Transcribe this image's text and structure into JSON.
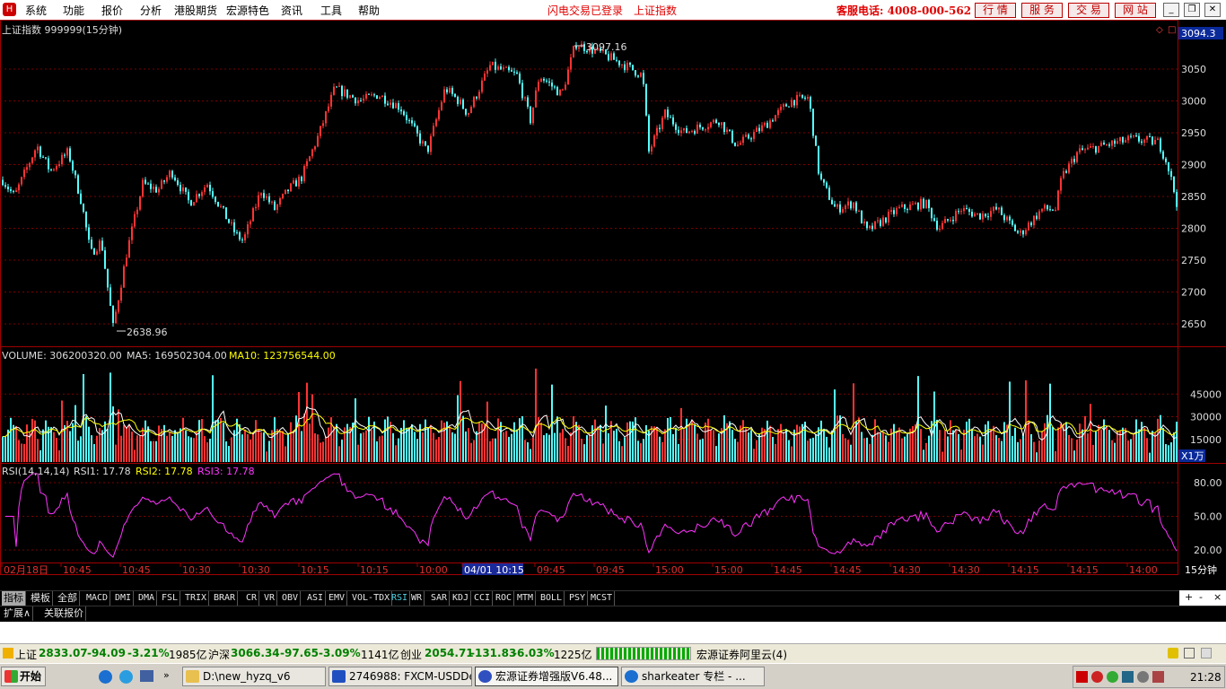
{
  "menu": {
    "items": [
      "系统",
      "功能",
      "报价",
      "分析",
      "港股期货",
      "宏源特色",
      "资讯",
      "工具",
      "帮助"
    ],
    "flash_status": "闪电交易已登录",
    "index_title": "上证指数",
    "hotline": "客服电话: 4008-000-562",
    "right_buttons": [
      "行 情",
      "服 务",
      "交 易",
      "网 站"
    ]
  },
  "main_chart": {
    "title": "上证指数 999999(15分钟)",
    "current_value": "3094.3",
    "y_ticks": [
      "3050",
      "3000",
      "2950",
      "2900",
      "2850",
      "2800",
      "2750",
      "2700",
      "2650"
    ],
    "high_label": "3097.16",
    "low_label": "2638.96",
    "up_color": "#ff3333",
    "down_color": "#54ffff"
  },
  "volume": {
    "label": "VOLUME: 306200320.00",
    "ma5": "MA5: 169502304.00",
    "ma10": "MA10: 123756544.00",
    "y_ticks": [
      "45000",
      "30000",
      "15000"
    ],
    "unit": "X1万"
  },
  "rsi": {
    "label": "RSI(14,14,14)",
    "rsi1": "RSI1: 17.78",
    "rsi2": "RSI2: 17.78",
    "rsi3": "RSI3: 17.78",
    "y_ticks": [
      "80.00",
      "50.00",
      "20.00"
    ],
    "line_color": "#ff33ff"
  },
  "time_axis": {
    "labels": [
      "02月18日",
      "10:45",
      "10:45",
      "10:30",
      "10:30",
      "10:15",
      "10:15",
      "10:00",
      "04/01 10:15",
      "09:45",
      "09:45",
      "15:00",
      "15:00",
      "14:45",
      "14:45",
      "14:30",
      "14:30",
      "14:15",
      "14:15",
      "14:00"
    ],
    "period": "15分钟"
  },
  "indicator_tabs": [
    "指标",
    "模板",
    "全部",
    "MACD",
    "DMI",
    "DMA",
    "FSL",
    "TRIX",
    "BRAR",
    "CR",
    "VR",
    "OBV",
    "ASI",
    "EMV",
    "VOL-TDX",
    "RSI",
    "WR",
    "SAR",
    "KDJ",
    "CCI",
    "ROC",
    "MTM",
    "BOLL",
    "PSY",
    "MCST"
  ],
  "extend_tabs": [
    "扩展∧",
    "关联报价"
  ],
  "status": {
    "sh_name": "上证",
    "sh_value": "2833.07",
    "sh_change": "-94.09",
    "sh_pct": "-3.21%",
    "sh_amount": "1985亿",
    "hs_name": "沪深",
    "hs_value": "3066.34",
    "hs_change": "-97.65",
    "hs_pct": "-3.09%",
    "hs_amount": "1141亿",
    "cy_name": "创业",
    "cy_value": "2054.71",
    "cy_change": "-131.83",
    "cy_pct": "-6.03%",
    "cy_amount": "1225亿",
    "server": "宏源证券阿里云(4)"
  },
  "taskbar": {
    "start": "开始",
    "windows": [
      "D:\\new_hyzq_v6",
      "2746988: FXCM-USDDe...",
      "宏源证券增强版V6.48...",
      "sharkeater 专栏 - ..."
    ],
    "clock": "21:28"
  }
}
